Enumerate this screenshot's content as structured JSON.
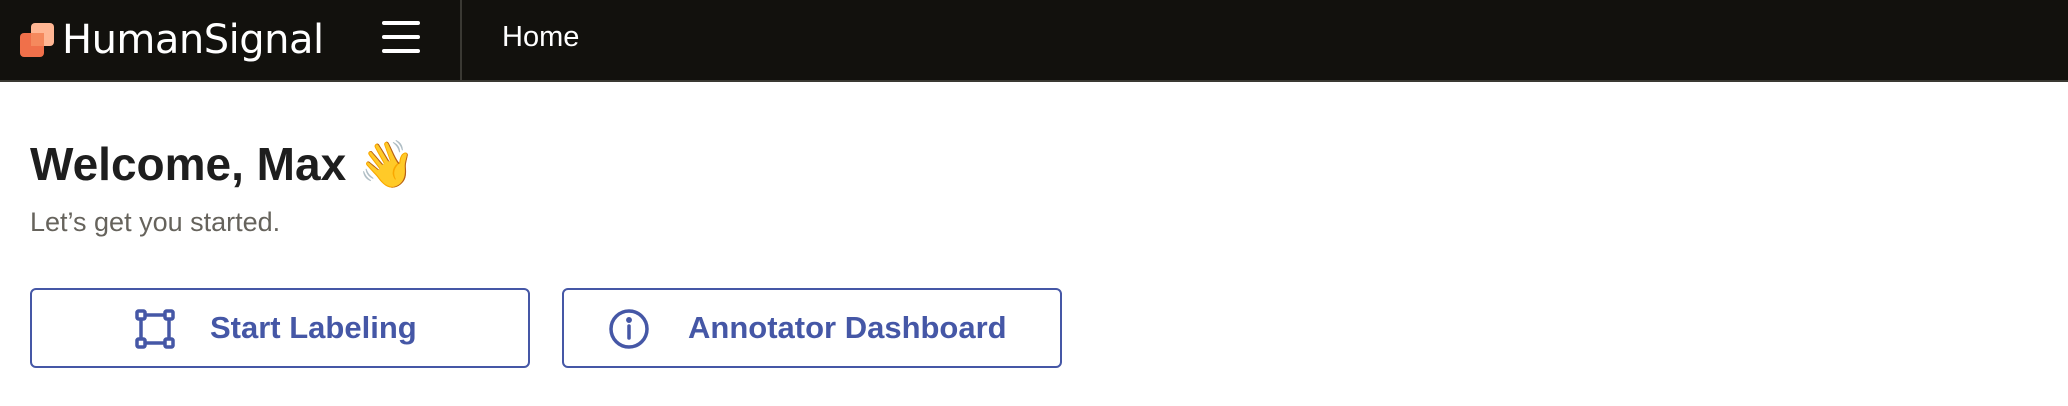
{
  "header": {
    "brand": "HumanSignal",
    "breadcrumb": "Home",
    "colors": {
      "background": "#12110d",
      "logo_orange": "#f0704a",
      "logo_light": "#ffb693"
    },
    "icons": {
      "logo": "humansignal-logo-icon",
      "menu": "hamburger-menu-icon"
    }
  },
  "main": {
    "welcome": "Welcome, Max",
    "wave_emoji": "👋",
    "subtitle": "Let’s get you started.",
    "actions": [
      {
        "label": "Start Labeling",
        "icon": "bounding-box-icon"
      },
      {
        "label": "Annotator Dashboard",
        "icon": "info-circle-icon"
      }
    ],
    "accent_color": "#4557a6"
  }
}
